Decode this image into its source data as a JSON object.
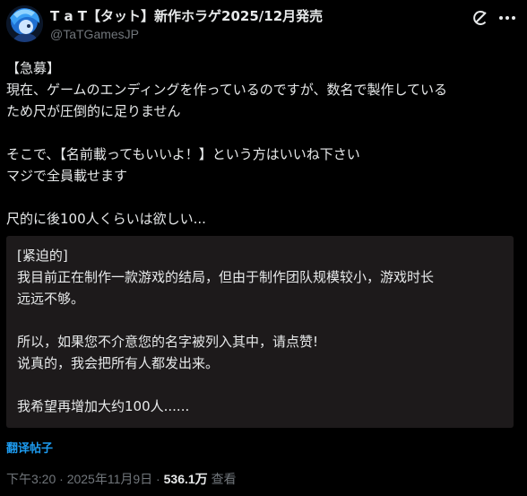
{
  "author": {
    "display_name": "T a T【タット】新作ホラゲ2025/12月発売",
    "handle": "@TaTGamesJP"
  },
  "post": {
    "lines": [
      "【急募】",
      "現在、ゲームのエンディングを作っているのですが、数名で製作している",
      "ため尺が圧倒的に足りません",
      "",
      "そこで、【名前載ってもいいよ！】という方はいいね下さい",
      "マジで全員載せます",
      "",
      "尺的に後100人くらいは欲しい..."
    ]
  },
  "translation": {
    "lines": [
      "[紧迫的]",
      "我目前正在制作一款游戏的结局，但由于制作团队规模较小，游戏时长",
      "远远不够。",
      "",
      "所以，如果您不介意您的名字被列入其中，请点赞!",
      "说真的，我会把所有人都发出来。",
      "",
      "我希望再增加大约100人......"
    ],
    "link_label": "翻译帖子"
  },
  "meta": {
    "time": "下午3:20",
    "separator": " · ",
    "date": "2025年11月9日",
    "views_count": "536.1万",
    "views_label": "查看"
  },
  "icons": {
    "grok": "grok-icon",
    "more": "more-options-icon"
  },
  "colors": {
    "background": "#000000",
    "text": "#e7e9ea",
    "muted": "#71767b",
    "link": "#1d9bf0",
    "translation_bg": "#1d1a1b"
  }
}
